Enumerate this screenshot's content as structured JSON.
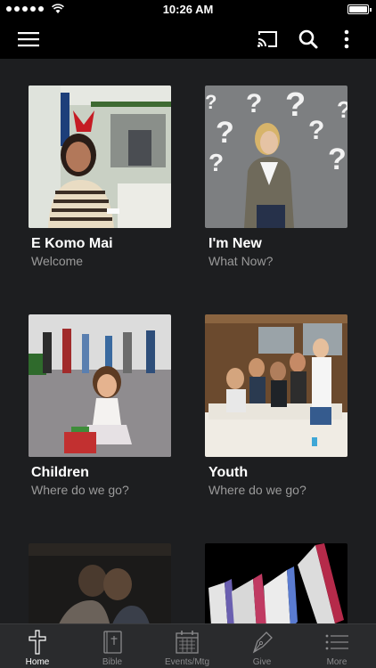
{
  "status": {
    "time": "10:26 AM"
  },
  "tiles": [
    {
      "title": "E Komo Mai",
      "subtitle": "Welcome"
    },
    {
      "title": "I'm New",
      "subtitle": "What Now?"
    },
    {
      "title": "Children",
      "subtitle": "Where do we go?"
    },
    {
      "title": "Youth",
      "subtitle": "Where do we go?"
    }
  ],
  "tabs": [
    {
      "label": "Home",
      "icon": "cross-icon"
    },
    {
      "label": "Bible",
      "icon": "bible-icon"
    },
    {
      "label": "Events/Mtg",
      "icon": "calendar-icon"
    },
    {
      "label": "Give",
      "icon": "pen-nib-icon"
    },
    {
      "label": "More",
      "icon": "list-icon"
    }
  ],
  "colors": {
    "background": "#1d1e20",
    "bar": "#000000",
    "subtitle": "#9a9a9a"
  }
}
